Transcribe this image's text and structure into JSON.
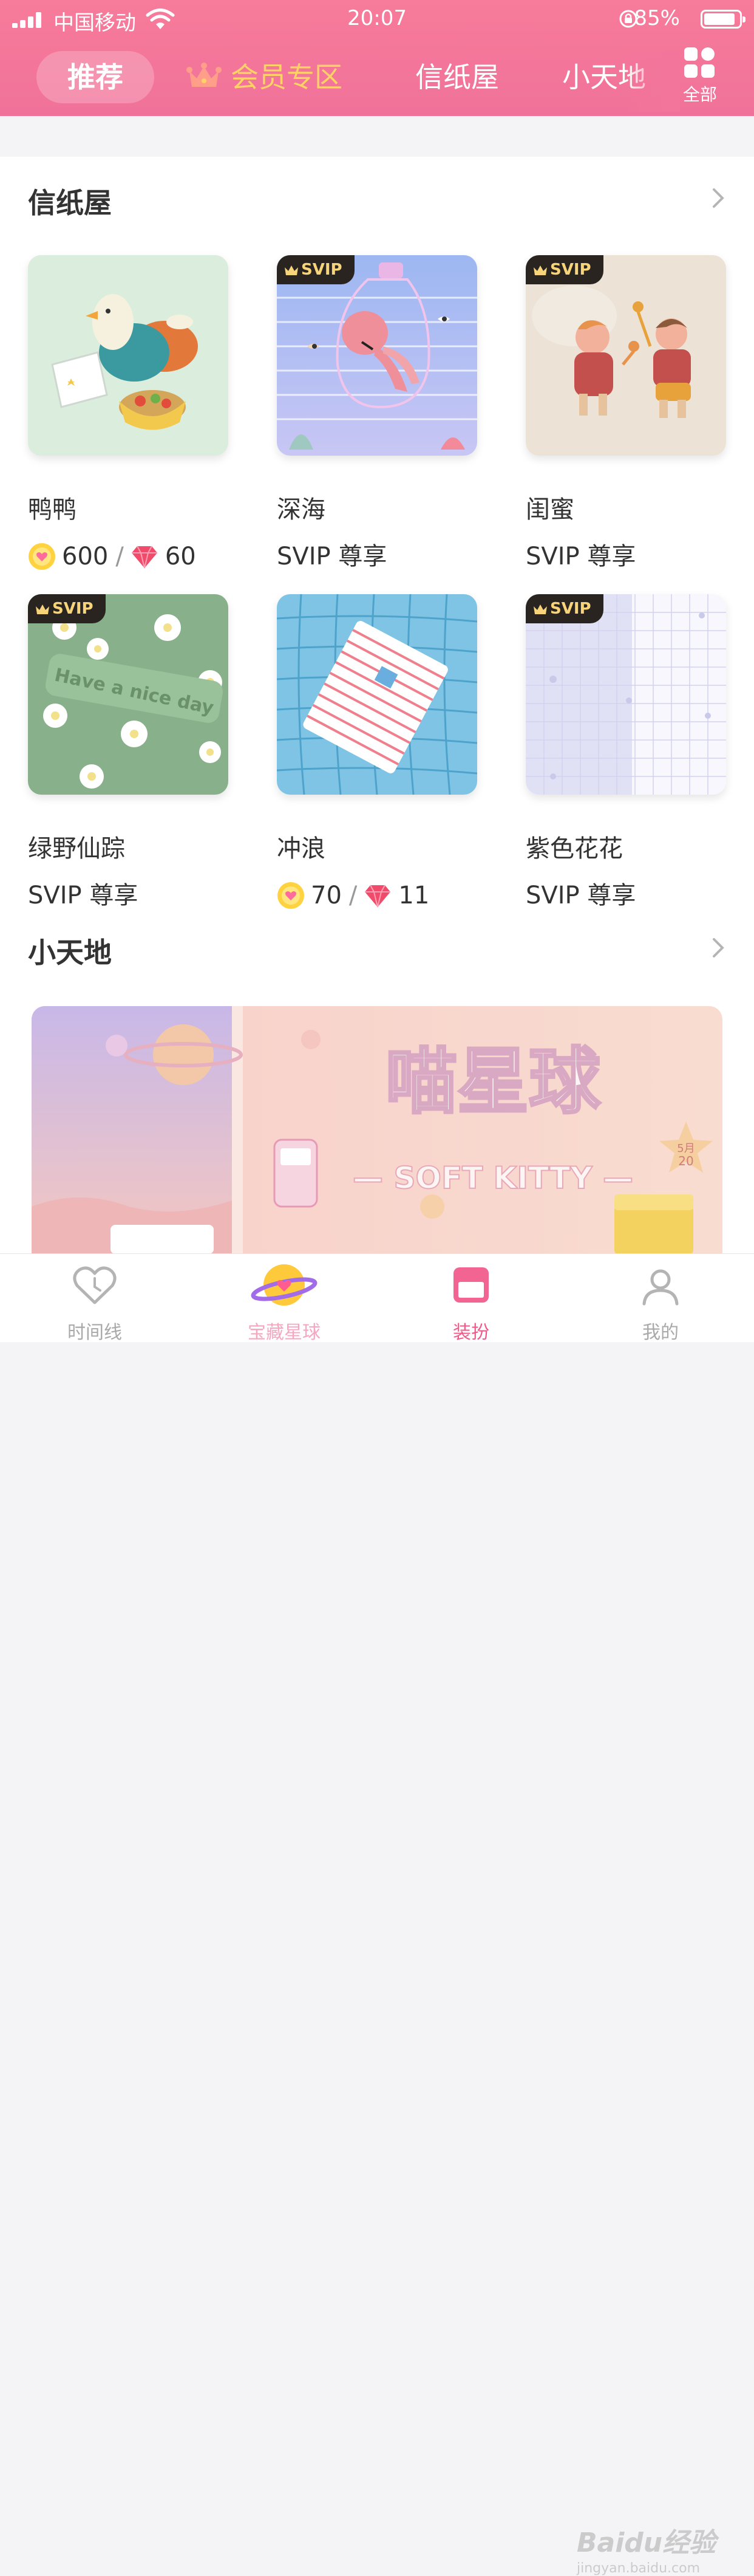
{
  "status_bar": {
    "carrier": "中国移动",
    "time": "20:07",
    "battery": "85%"
  },
  "top_tabs": [
    {
      "label": "推荐",
      "active": true
    },
    {
      "label": "会员专区"
    },
    {
      "label": "信纸屋"
    },
    {
      "label": "小天地"
    }
  ],
  "all_button": {
    "label": "全部"
  },
  "sections": {
    "letter_house": {
      "title": "信纸屋",
      "items": [
        {
          "name": "鸭鸭",
          "svip": false,
          "coins": "600",
          "gems": "60"
        },
        {
          "name": "深海",
          "svip": true,
          "badge": "SVIP",
          "price_text": "SVIP 尊享"
        },
        {
          "name": "闺蜜",
          "svip": true,
          "badge": "SVIP",
          "price_text": "SVIP 尊享"
        },
        {
          "name": "绿野仙踪",
          "svip": true,
          "badge": "SVIP",
          "price_text": "SVIP 尊享",
          "thumb_text": "Have a nice day"
        },
        {
          "name": "冲浪",
          "svip": false,
          "coins": "70",
          "gems": "11"
        },
        {
          "name": "紫色花花",
          "svip": true,
          "badge": "SVIP",
          "price_text": "SVIP 尊享"
        }
      ]
    },
    "small_world": {
      "title": "小天地",
      "banner": {
        "title": "喵星球",
        "subtitle": "— SOFT KITTY —",
        "date_month": "5月",
        "date_day": "20"
      }
    }
  },
  "bottom_nav": [
    {
      "label": "时间线",
      "active": false
    },
    {
      "label": "宝藏星球",
      "active": false
    },
    {
      "label": "装扮",
      "active": true
    },
    {
      "label": "我的",
      "active": false
    }
  ],
  "watermark": {
    "main": "Baidu经验",
    "sub": "jingyan.baidu.com"
  },
  "colors": {
    "header": "#f3759b",
    "vip_gold": "#ffd166",
    "active_tab": "#f0598a",
    "badge_bg": "#2a2420"
  }
}
